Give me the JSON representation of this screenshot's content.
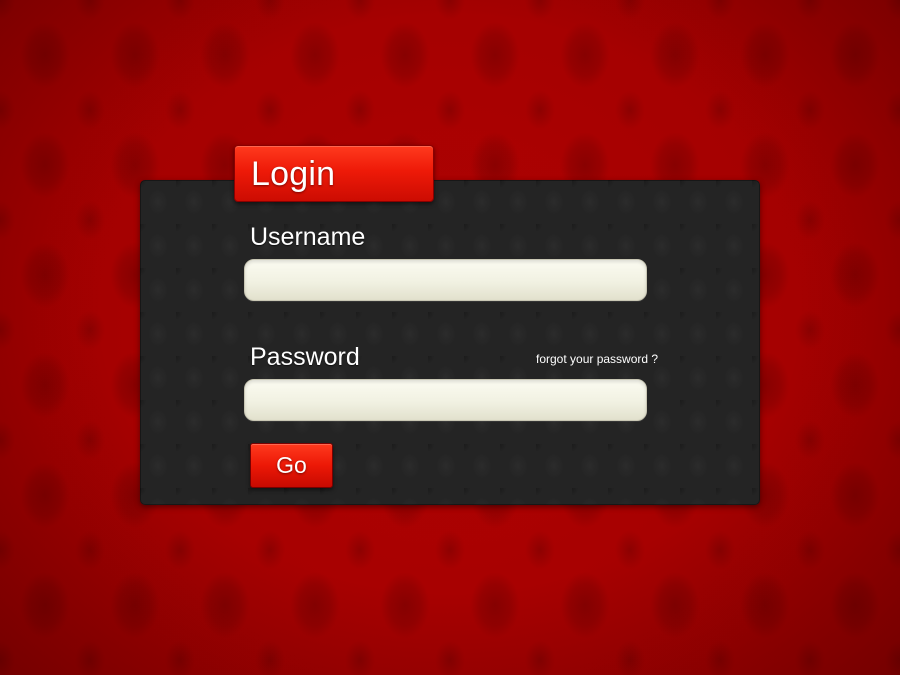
{
  "login_card": {
    "title": "Login",
    "username": {
      "label": "Username",
      "value": "",
      "placeholder": ""
    },
    "password": {
      "label": "Password",
      "value": "",
      "placeholder": ""
    },
    "forgot_password_link": "forgot your password ?",
    "submit_label": "Go"
  },
  "colors": {
    "background": "#a40000",
    "panel": "#242424",
    "accent": "#e8180a",
    "input_fill": "#f1f1e2",
    "text": "#ffffff"
  }
}
